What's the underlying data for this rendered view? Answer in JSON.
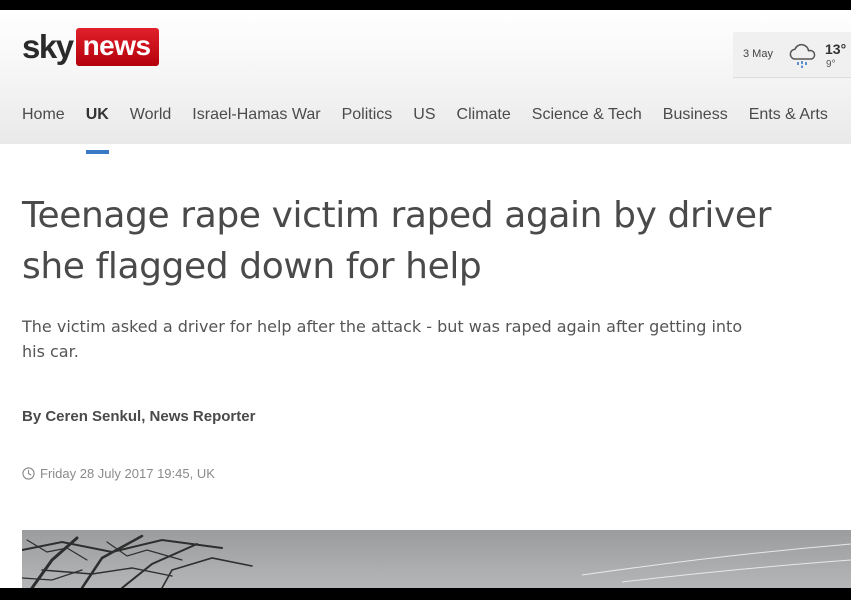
{
  "header": {
    "logo_text": "sky",
    "logo_badge": "news",
    "weather": {
      "date": "3 May",
      "high": "13°",
      "low": "9°",
      "icon": "rain-cloud-icon"
    }
  },
  "nav": {
    "items": [
      {
        "label": "Home"
      },
      {
        "label": "UK"
      },
      {
        "label": "World"
      },
      {
        "label": "Israel-Hamas War"
      },
      {
        "label": "Politics"
      },
      {
        "label": "US"
      },
      {
        "label": "Climate"
      },
      {
        "label": "Science & Tech"
      },
      {
        "label": "Business"
      },
      {
        "label": "Ents & Arts"
      }
    ],
    "active": "UK"
  },
  "article": {
    "headline_line1": "Teenage rape victim raped again by driver",
    "headline_line2": "she flagged down for help",
    "standfirst_line1": "The victim asked a driver for help after the attack - but was raped again after getting into",
    "standfirst_line2": "his car.",
    "byline": "By Ceren Senkul, News Reporter",
    "timestamp": "Friday 28 July 2017 19:45, UK"
  },
  "colors": {
    "brand_red": "#c8101b",
    "accent_blue": "#3a79c6",
    "text": "#4a4a4a"
  }
}
